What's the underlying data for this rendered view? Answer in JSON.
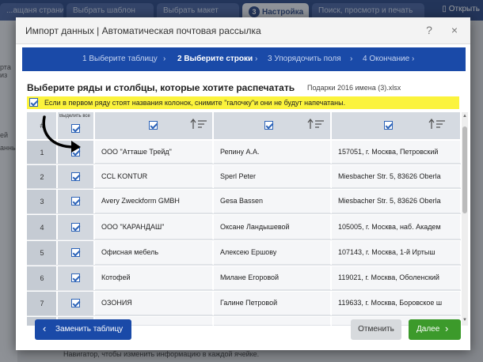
{
  "background": {
    "tabs": [
      {
        "label": "...ащаня страница",
        "active": false
      },
      {
        "label": "Выбрать шаблон",
        "active": false
      },
      {
        "label": "Выбрать макет",
        "active": false
      },
      {
        "num": "3",
        "label": "Настройка",
        "active": true
      },
      {
        "label": "Поиск, просмотр и печать",
        "active": false
      }
    ],
    "open_label": "Открыть",
    "left_labels": [
      "рта из",
      "",
      "ей",
      "анны"
    ],
    "bottom_text": "Редактируйте текст и создавайте дизайн, затем перейдите в режим \"Редактировать одни\" и используйте Навигатор, чтобы изменить информацию в каждой ячейке."
  },
  "dialog": {
    "title": "Импорт данных | Автоматическая почтовая рассылка",
    "help": "?",
    "close": "×",
    "steps": [
      {
        "label": "1 Выберите таблицу",
        "active": false
      },
      {
        "label": "2 Выберите строки",
        "active": true
      },
      {
        "label": "3 Упорядочить поля",
        "active": false
      },
      {
        "label": "4 Окончание",
        "active": false
      }
    ],
    "step_separator": "›",
    "section_title": "Выберите ряды и столбцы, которые хотите распечатать",
    "file_name": "Подарки 2016 имена (3).xlsx",
    "notice": "Если в первом ряду стоят названия колонок, снимите \"галочку\"и они не будут напечатаны.",
    "table": {
      "num_header": "#",
      "select_all_header": "Выделить все",
      "rows": [
        {
          "num": "1",
          "company": "ООО \"Атташе Трейд\"",
          "name": "Репину А.А.",
          "address": "157051, г. Москва, Петровский"
        },
        {
          "num": "2",
          "company": "CCL KONTUR",
          "name": "Sperl Peter",
          "address": "Miesbacher Str. 5, 83626 Oberla"
        },
        {
          "num": "3",
          "company": "Avery Zweckform GMBH",
          "name": "Gesa Bassen",
          "address": "Miesbacher Str. 5, 83626 Oberla"
        },
        {
          "num": "4",
          "company": "ООО \"КАРАНДАШ\"",
          "name": "Оксане Ландышевой",
          "address": "105005, г. Москва, наб. Академ"
        },
        {
          "num": "5",
          "company": "Офисная мебель",
          "name": "Алексею Ершову",
          "address": "107143, г. Москва, 1-й Иртыш"
        },
        {
          "num": "6",
          "company": "Котофей",
          "name": "Милане Егоровой",
          "address": "119021, г. Москва, Оболенский"
        },
        {
          "num": "7",
          "company": "ОЗОНИЯ",
          "name": "Галине Петровой",
          "address": "119633, г. Москва, Боровское ш"
        }
      ]
    },
    "buttons": {
      "replace": "Заменить таблицу",
      "cancel": "Отменить",
      "next": "Далее"
    }
  }
}
